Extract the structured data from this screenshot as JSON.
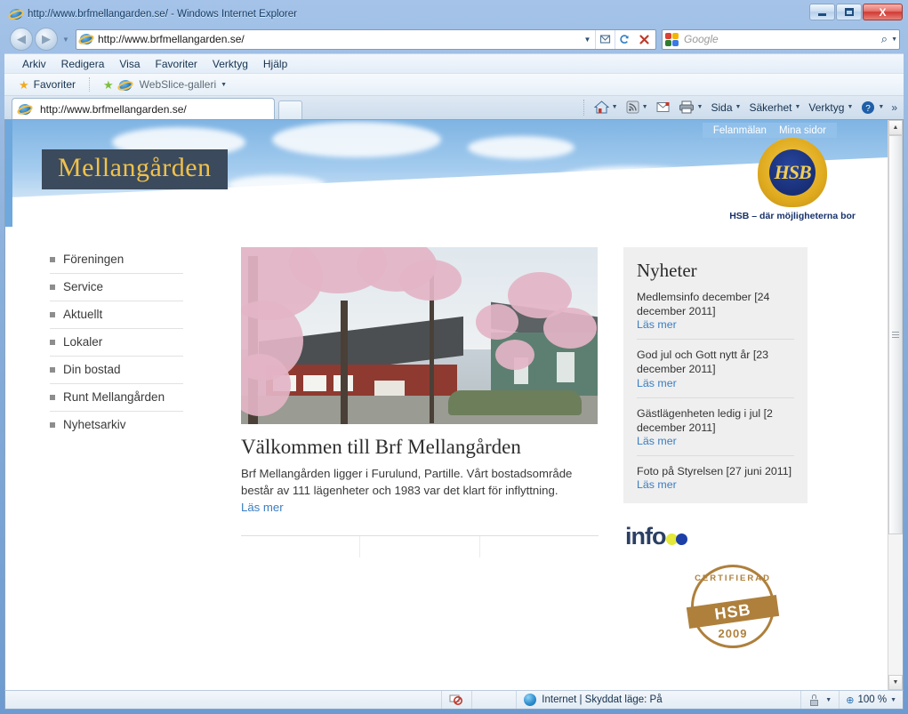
{
  "window": {
    "title": "http://www.brfmellangarden.se/ - Windows Internet Explorer",
    "minimize_label": "Minimera",
    "maximize_label": "Maximera",
    "close_label": "X"
  },
  "toolbar": {
    "back_label": "◀",
    "forward_label": "▶",
    "history_caret": "▼",
    "address_value": "http://www.brfmellangarden.se/",
    "address_dropdown": "▼",
    "compat_label": "▨",
    "refresh_label": "↻",
    "stop_label": "✕",
    "search_placeholder": "Google",
    "search_magnifier": "⌕",
    "search_dropdown": "▼"
  },
  "menubar": {
    "items": [
      {
        "label": "Arkiv"
      },
      {
        "label": "Redigera"
      },
      {
        "label": "Visa"
      },
      {
        "label": "Favoriter"
      },
      {
        "label": "Verktyg"
      },
      {
        "label": "Hjälp"
      }
    ]
  },
  "favoritesbar": {
    "favorites_label": "Favoriter",
    "webslice_label": "WebSlice-galleri",
    "webslice_caret": "▼"
  },
  "tabstrip": {
    "tab_title": "http://www.brfmellangarden.se/",
    "newtab_label": ""
  },
  "commandbar": {
    "items": [
      {
        "name": "home",
        "label": "",
        "caret": "▼"
      },
      {
        "name": "feeds",
        "label": "",
        "caret": "▼"
      },
      {
        "name": "mail",
        "label": "",
        "caret": ""
      },
      {
        "name": "print",
        "label": "",
        "caret": "▼"
      },
      {
        "name": "page",
        "label": "Sida",
        "caret": "▼"
      },
      {
        "name": "safety",
        "label": "Säkerhet",
        "caret": "▼"
      },
      {
        "name": "tools",
        "label": "Verktyg",
        "caret": "▼"
      },
      {
        "name": "help",
        "label": "",
        "caret": "▼"
      }
    ],
    "overflow": "»"
  },
  "site": {
    "topbar": {
      "links": [
        {
          "label": "Felanmälan"
        },
        {
          "label": "Mina sidor"
        }
      ]
    },
    "logo_text": "Mellangården",
    "hsb": {
      "crest_text": "HSB",
      "tagline": "HSB – där möjligheterna bor"
    },
    "sidebar": {
      "items": [
        {
          "label": "Föreningen"
        },
        {
          "label": "Service"
        },
        {
          "label": "Aktuellt"
        },
        {
          "label": "Lokaler"
        },
        {
          "label": "Din bostad"
        },
        {
          "label": "Runt Mellangården"
        },
        {
          "label": "Nyhetsarkiv"
        }
      ]
    },
    "main": {
      "hero_alt": "Bostadsområde med körsbärsträd i blom",
      "heading": "Välkommen till Brf Mellangården",
      "body": "Brf Mellangården ligger i Furulund, Partille. Vårt bostadsområde består av 111 lägenheter och 1983 var det klart för inflyttning.",
      "readmore": "Läs mer"
    },
    "news": {
      "title": "Nyheter",
      "readmore_label": "Läs mer",
      "items": [
        {
          "title": "Medlemsinfo december [24 december 2011]",
          "link": "Läs mer"
        },
        {
          "title": "God jul och Gott nytt år [23 december 2011]",
          "link": "Läs mer"
        },
        {
          "title": "Gästlägenheten ledig i jul [2 december 2011]",
          "link": "Läs mer"
        },
        {
          "title": "Foto på Styrelsen [27 juni 2011]",
          "link": "Läs mer"
        }
      ]
    },
    "infoo_logo": "info",
    "stamp": {
      "top_text": "CERTIFIERAD",
      "center_text": "HSB",
      "year": "2009"
    }
  },
  "statusbar": {
    "zone_text": "Internet | Skyddat läge: På",
    "zoom_level": "100 %",
    "zoom_caret": "▼",
    "protected_caret": "▼"
  },
  "colors": {
    "accent_blue": "#3b7ec1",
    "logo_gold": "#f0c14b",
    "logo_box": "#3b4a5c",
    "stamp_brown": "#a8762c",
    "news_bg": "#efefef"
  }
}
